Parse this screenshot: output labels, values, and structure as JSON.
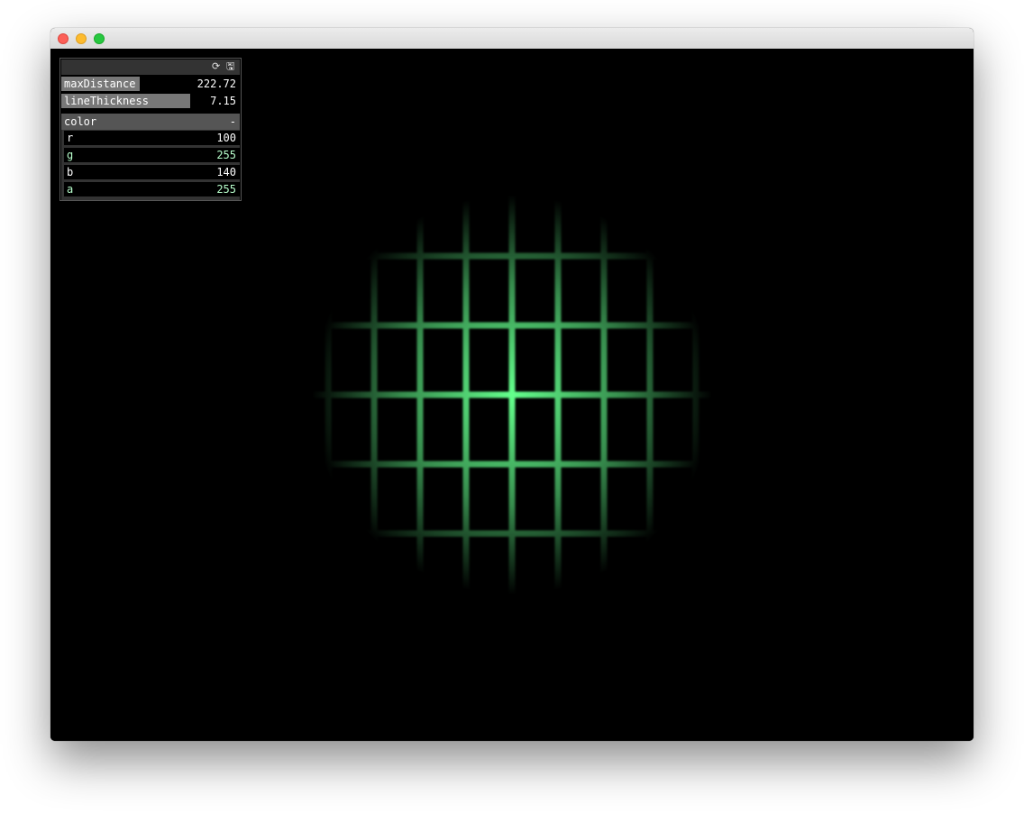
{
  "window": {
    "controls": [
      "close",
      "minimize",
      "maximize"
    ]
  },
  "gui": {
    "header_icons": [
      "refresh-icon",
      "save-icon"
    ],
    "sliders": [
      {
        "name": "maxDistance",
        "value": "222.72",
        "fraction": 0.44,
        "fill_color": "#787878"
      },
      {
        "name": "lineThickness",
        "value": "7.15",
        "fraction": 0.72,
        "fill_color": "#787878"
      }
    ],
    "color_group": {
      "label": "color",
      "collapse_label": "-",
      "channels": [
        {
          "name": "r",
          "value": "100",
          "fraction": 0.392
        },
        {
          "name": "g",
          "value": "255",
          "fraction": 1.0
        },
        {
          "name": "b",
          "value": "140",
          "fraction": 0.549
        },
        {
          "name": "a",
          "value": "255",
          "fraction": 1.0
        }
      ],
      "fill_color": "#64ff8c"
    }
  },
  "scene": {
    "line_color": "#64ff8c",
    "background": "#000000"
  }
}
